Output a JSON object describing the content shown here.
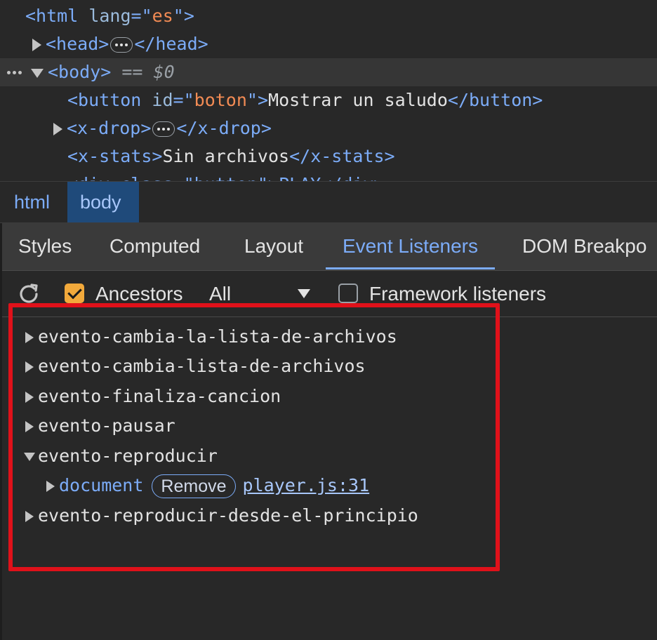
{
  "dom_tree": {
    "html_open": {
      "tag_open": "<html",
      "attr": "lang",
      "eq": "=\"",
      "value": "es",
      "close": "\">"
    },
    "head": {
      "open": "<head>",
      "close": "</head>"
    },
    "body": {
      "open": "<body>",
      "suffix": " == ",
      "ref": "$0"
    },
    "button_line": {
      "open": "<button",
      "attr": "id",
      "eq": "=\"",
      "value": "boton",
      "close": "\">",
      "text": "Mostrar un saludo",
      "end": "</button>"
    },
    "xdrop": {
      "open": "<x-drop>",
      "close": "</x-drop>"
    },
    "xstats": {
      "open": "<x-stats>",
      "text": "Sin archivos",
      "close": "</x-stats>"
    },
    "partial_line": "<div class=\"button\">PLAY</div>"
  },
  "breadcrumb": {
    "items": [
      "html",
      "body"
    ]
  },
  "tabs": [
    "Styles",
    "Computed",
    "Layout",
    "Event Listeners",
    "DOM Breakpo"
  ],
  "toolbar": {
    "ancestors_label": "Ancestors",
    "ancestors_checked": true,
    "filter_value": "All",
    "framework_label": "Framework listeners",
    "framework_checked": false
  },
  "events": [
    "evento-cambia-la-lista-de-archivos",
    "evento-cambia-lista-de-archivos",
    "evento-finaliza-cancion",
    "evento-pausar",
    "evento-reproducir",
    "evento-reproducir-desde-el-principio"
  ],
  "expanded_listener": {
    "node": "document",
    "remove_label": "Remove",
    "source": "player.js:31"
  },
  "colors": {
    "highlight": "#e0111a",
    "tag": "#7cacf8",
    "attr_value": "#f28b54",
    "checkbox": "#f2a93b"
  }
}
